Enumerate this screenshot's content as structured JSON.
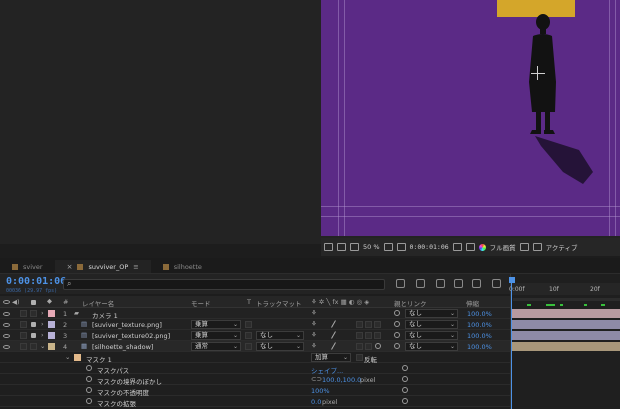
{
  "tabs": [
    {
      "label": "sviver",
      "color": "#8b6a3a",
      "active": false
    },
    {
      "label": "suvviver_OP",
      "color": "#8b6a3a",
      "active": true
    },
    {
      "label": "silhoette",
      "color": "#8b6a3a",
      "active": false
    }
  ],
  "viewer": {
    "zoom": "50 %",
    "timecode": "0:00:01:06",
    "resolution": "フル画質",
    "active_camera": "アクティブ",
    "colors": {
      "comp_bg": "#5b2a86",
      "yellow_block": "#d4a62a"
    }
  },
  "timeline": {
    "current_time": "0:00:01:06",
    "current_time_sub": "00036 (29.97 fps)",
    "search_placeholder": "",
    "search_icon": "search-icon",
    "columns": {
      "num": "#",
      "layer_name": "レイヤー名",
      "mode": "モード",
      "t": "T",
      "trackmatte": "トラックマット",
      "parent": "親とリンク",
      "stretch": "伸縮"
    },
    "layers": [
      {
        "num": "1",
        "name": "カメラ 1",
        "label_color": "#e6a9b6",
        "mode": "",
        "trackmatte": "",
        "parent": "なし",
        "stretch": "100.0%"
      },
      {
        "num": "2",
        "name": "[suviver_texture.png]",
        "label_color": "#b7b1d6",
        "mode": "乗算",
        "trackmatte": "",
        "parent": "なし",
        "stretch": "100.0%"
      },
      {
        "num": "3",
        "name": "[suviver_texture02.png]",
        "label_color": "#b7b1d6",
        "mode": "乗算",
        "trackmatte": "なし",
        "parent": "なし",
        "stretch": "100.0%"
      },
      {
        "num": "4",
        "name": "[silhoette_shadow]",
        "label_color": "#c9b48a",
        "mode": "通常",
        "trackmatte": "なし",
        "parent": "なし",
        "stretch": "100.0%"
      }
    ],
    "mask": {
      "name": "マスク 1",
      "mode": "加算",
      "invert_label": "反転",
      "properties": [
        {
          "name": "マスクパス",
          "value": "シェイプ..."
        },
        {
          "name": "マスクの境界のぼかし",
          "value": "100.0,100.0",
          "unit": "pixel"
        },
        {
          "name": "マスクの不透明度",
          "value": "100%",
          "unit": ""
        },
        {
          "name": "マスクの拡張",
          "value": "0.0",
          "unit": "pixel"
        }
      ]
    },
    "ruler": {
      "ticks": [
        "0:00f",
        "10f",
        "20f"
      ]
    },
    "colors": {
      "accent": "#4d92e6",
      "keyframe": "#39c03c"
    }
  }
}
